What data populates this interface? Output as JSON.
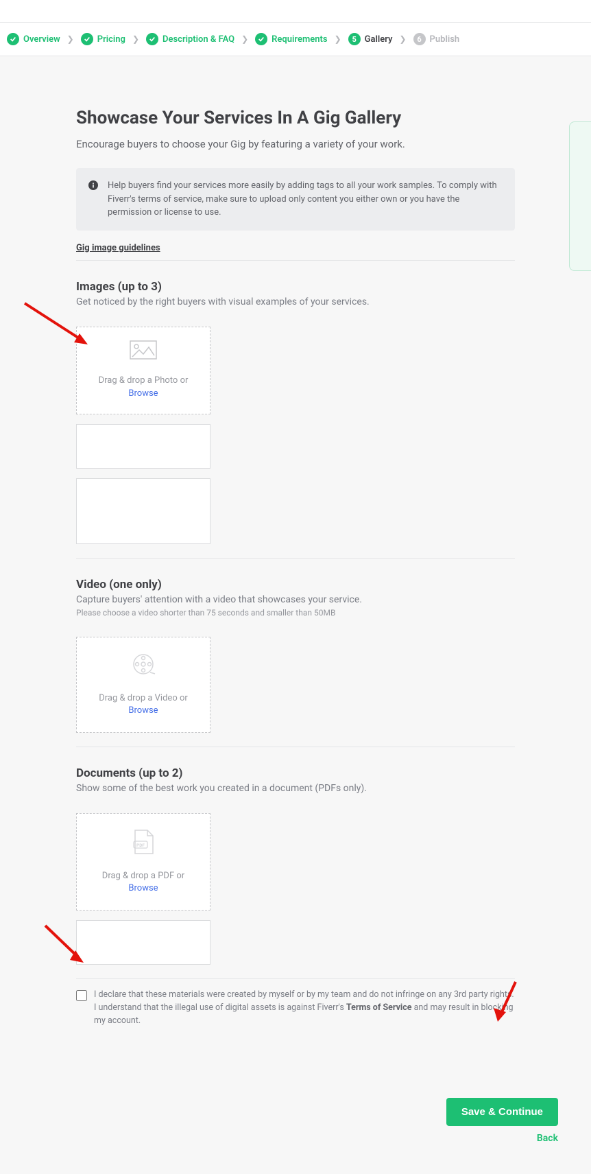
{
  "steps": [
    {
      "label": "Overview",
      "state": "done"
    },
    {
      "label": "Pricing",
      "state": "done"
    },
    {
      "label": "Description & FAQ",
      "state": "done"
    },
    {
      "label": "Requirements",
      "state": "done"
    },
    {
      "label": "Gallery",
      "state": "current",
      "number": "5"
    },
    {
      "label": "Publish",
      "state": "upcoming",
      "number": "6"
    }
  ],
  "page": {
    "title": "Showcase Your Services In A Gig Gallery",
    "subtitle": "Encourage buyers to choose your Gig by featuring a variety of your work."
  },
  "info": {
    "text": "Help buyers find your services more easily by adding tags to all your work samples. To comply with Fiverr's terms of service, make sure to upload only content you either own or you have the permission or license to use."
  },
  "guidelines_link": "Gig image guidelines",
  "images_section": {
    "title": "Images (up to 3)",
    "subtitle": "Get noticed by the right buyers with visual examples of your services.",
    "drop_text": "Drag & drop a Photo or",
    "browse": "Browse"
  },
  "video_section": {
    "title": "Video (one only)",
    "subtitle": "Capture buyers' attention with a video that showcases your service.",
    "note": "Please choose a video shorter than 75 seconds and smaller than 50MB",
    "drop_text": "Drag & drop a Video or",
    "browse": "Browse"
  },
  "documents_section": {
    "title": "Documents (up to 2)",
    "subtitle": "Show some of the best work you created in a document (PDFs only).",
    "drop_text": "Drag & drop a PDF or",
    "browse": "Browse"
  },
  "declaration": {
    "text_part1": "I declare that these materials were created by myself or by my team and do not infringe on any 3rd party rights. I understand that the illegal use of digital assets is against Fiverr's ",
    "tos": "Terms of Service",
    "text_part2": " and may result in blocking my account."
  },
  "actions": {
    "save": "Save & Continue",
    "back": "Back"
  }
}
